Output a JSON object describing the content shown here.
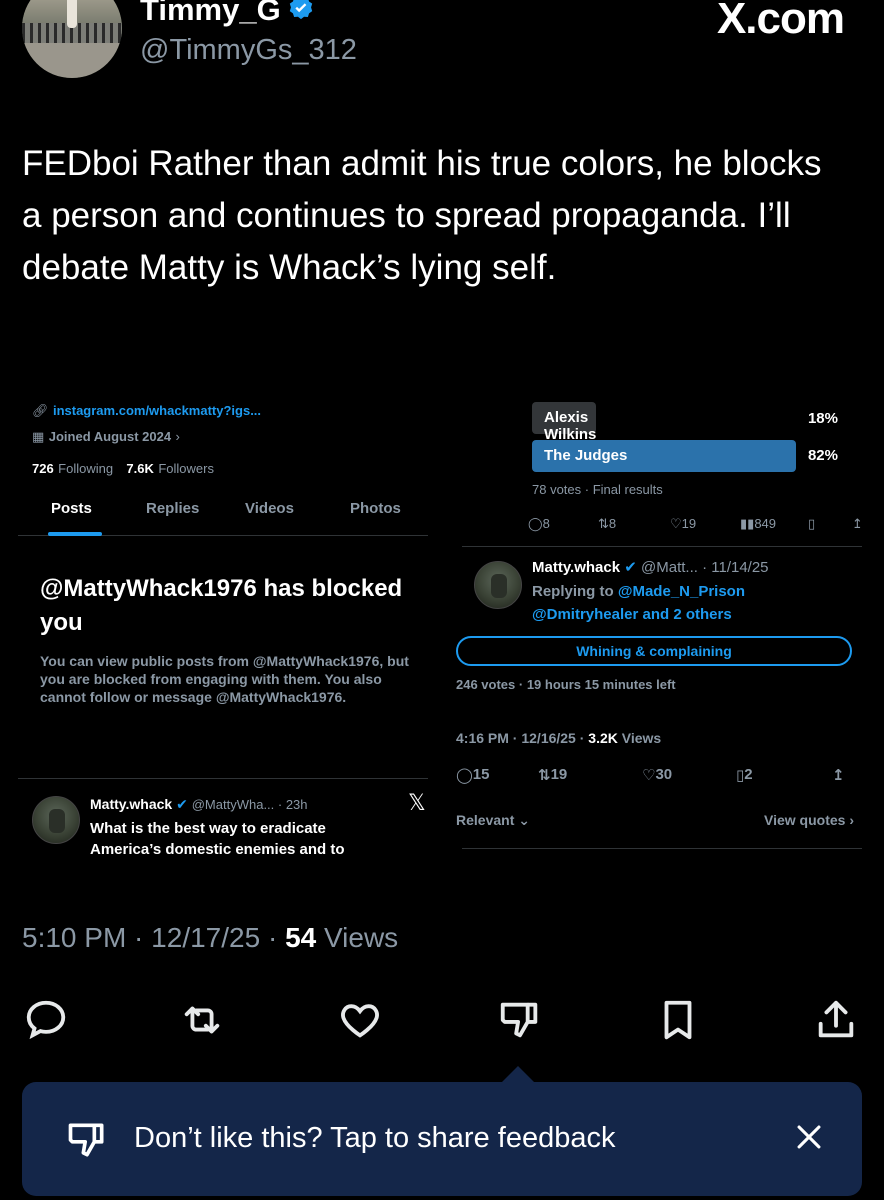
{
  "header": {
    "display_name": "Timmy_G",
    "handle": "@TimmyGs_312",
    "watermark": "X.com"
  },
  "tweet": {
    "text": "FEDboi Rather than admit his true colors, he blocks a person and continues to spread propaganda. I’ll debate Matty is Whack’s lying self.",
    "time": "5:10 PM",
    "date": "12/17/25",
    "views_count": "54",
    "views_label": "Views"
  },
  "left_panel": {
    "profile_link": "instagram.com/whackmatty?igs...",
    "joined": "Joined August 2024",
    "following_count": "726",
    "following_label": "Following",
    "followers_count": "7.6K",
    "followers_label": "Followers",
    "tabs": [
      "Posts",
      "Replies",
      "Videos",
      "Photos"
    ],
    "blocked_title": "@MattyWhack1976 has blocked you",
    "blocked_body": "You can view public posts from @MattyWhack1976, but you are blocked from engaging with them. You also cannot follow or message @MattyWhack1976.",
    "post_name": "Matty.whack",
    "post_handle": "@MattyWha... · 23h",
    "post_text": "What is the best way to eradicate America’s domestic enemies and to"
  },
  "right_panel": {
    "poll": [
      {
        "label": "Alexis Wilkins",
        "pct": "18%",
        "fraction": 0.18
      },
      {
        "label": "The Judges",
        "pct": "82%",
        "fraction": 0.82
      }
    ],
    "poll_meta": "78 votes · Final results",
    "actions": {
      "replies": "8",
      "reposts": "8",
      "likes": "19",
      "views": "849"
    },
    "reply_name": "Matty.whack",
    "reply_handle": "@Matt... · 11/14/25",
    "replying_to_label": "Replying to",
    "replying_to_user": "@Made_N_Prison",
    "replying_to_more": "@Dmitryhealer and 2 others",
    "poll2_option": "Whining & complaining",
    "poll2_meta": "246 votes · 19 hours 15 minutes left",
    "post_time": "4:16 PM · 12/16/25 ·",
    "post_views": "3.2K",
    "post_views_label": "Views",
    "post_actions": {
      "replies": "15",
      "reposts": "19",
      "likes": "30",
      "bookmarks": "2"
    },
    "relevant": "Relevant",
    "view_quotes": "View quotes"
  },
  "feedback": {
    "text": "Don’t like this? Tap to share feedback"
  },
  "colors": {
    "accent": "#1d9bf0",
    "feedback_bg": "#142649",
    "muted": "#8b98a5"
  }
}
